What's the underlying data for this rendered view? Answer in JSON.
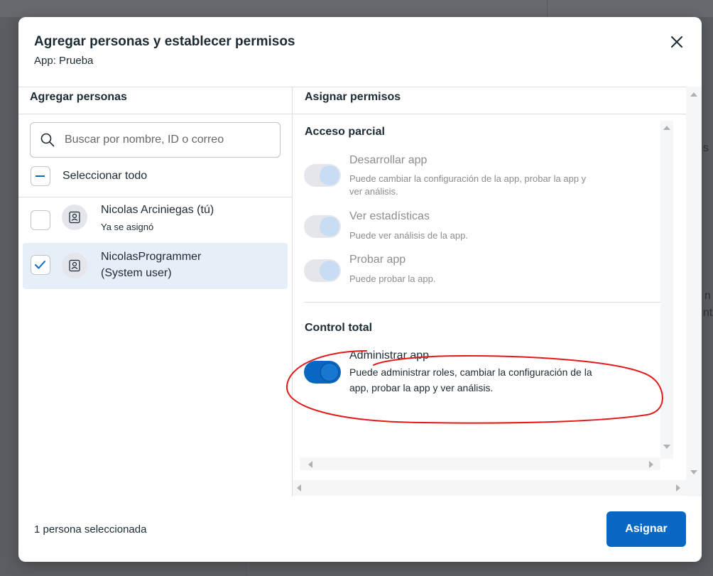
{
  "modal": {
    "title": "Agregar personas y establecer permisos",
    "subtitle": "App: Prueba"
  },
  "left": {
    "heading": "Agregar personas",
    "search_placeholder": "Buscar por nombre, ID o correo",
    "select_all_label": "Seleccionar todo",
    "people": [
      {
        "name": "Nicolas Arciniegas (tú)",
        "note": "Ya se asignó",
        "selected": false
      },
      {
        "name_line1": "NicolasProgrammer",
        "name_line2": "(System user)",
        "selected": true
      }
    ]
  },
  "right": {
    "heading": "Asignar permisos",
    "partial": {
      "title": "Acceso parcial",
      "items": [
        {
          "name": "Desarrollar app",
          "desc_line1": "Puede cambiar la configuración de la app, probar la app y",
          "desc_line2": "ver análisis."
        },
        {
          "name": "Ver estadísticas",
          "desc_line1": "Puede ver análisis de la app."
        },
        {
          "name": "Probar app",
          "desc_line1": "Puede probar la app."
        }
      ]
    },
    "full": {
      "title": "Control total",
      "items": [
        {
          "name": "Administrar app",
          "desc_line1": "Puede administrar roles, cambiar la configuración de la",
          "desc_line2": "app, probar la app y ver análisis."
        }
      ]
    }
  },
  "footer": {
    "selected_count": "1 persona seleccionada",
    "assign_label": "Asignar"
  },
  "background": {
    "fragment1": "s",
    "fragment2a": "n",
    "fragment2b": "nt"
  },
  "colors": {
    "accent": "#0a68c4",
    "annotation": "#e21a1a"
  }
}
